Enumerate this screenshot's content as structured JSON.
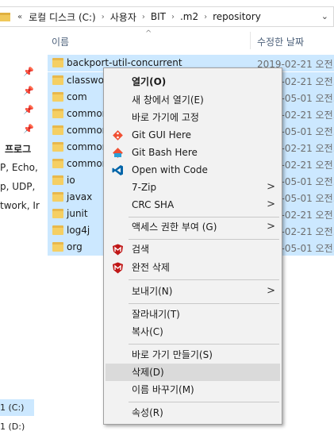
{
  "address": {
    "overflow": "«",
    "crumbs": [
      "로컬 디스크 (C:)",
      "사용자",
      "BIT",
      ".m2",
      "repository"
    ]
  },
  "columns": {
    "name": "이름",
    "date": "수정한 날짜",
    "sort_indicator": "^"
  },
  "nav": {
    "pins": [
      "📌",
      "📌",
      "📌",
      "📌"
    ],
    "texts": [
      "프로그",
      "P, Echo,",
      "p, UDP,",
      "twork, Ir"
    ],
    "drives": [
      "1 (C:)",
      "1 (D:)"
    ]
  },
  "files": [
    {
      "name": "backport-util-concurrent",
      "date": "2019-02-21 오전..."
    },
    {
      "name": "classworlds",
      "date": "2019-02-21 오전..."
    },
    {
      "name": "com",
      "date": "2019-05-01 오전..."
    },
    {
      "name": "commons-",
      "date": "2019-02-21 오전..."
    },
    {
      "name": "commons-",
      "date": "2019-05-01 오전..."
    },
    {
      "name": "commons-",
      "date": "2019-02-21 오전..."
    },
    {
      "name": "commons-",
      "date": "2019-02-21 오전..."
    },
    {
      "name": "io",
      "date": "2019-05-01 오전..."
    },
    {
      "name": "javax",
      "date": "2019-05-01 오전..."
    },
    {
      "name": "junit",
      "date": "2019-02-21 오전..."
    },
    {
      "name": "log4j",
      "date": "2019-02-21 오전..."
    },
    {
      "name": "org",
      "date": "2019-05-01 오전..."
    }
  ],
  "menu": {
    "open": "열기(O)",
    "open_new_window": "새 창에서 열기(E)",
    "pin_quick_access": "바로 가기에 고정",
    "git_gui": "Git GUI Here",
    "git_bash": "Git Bash Here",
    "open_with_code": "Open with Code",
    "sevenzip": "7-Zip",
    "crc_sha": "CRC SHA",
    "grant_access": "액세스 권한 부여 (G)",
    "scan": "검색",
    "full_delete": "완전 삭제",
    "send_to": "보내기(N)",
    "cut": "잘라내기(T)",
    "copy": "복사(C)",
    "create_shortcut": "바로 가기 만들기(S)",
    "delete": "삭제(D)",
    "rename": "이름 바꾸기(M)",
    "properties": "속성(R)",
    "submenu_arrow": ">"
  },
  "colors": {
    "selection": "#cce8ff",
    "menu_bg": "#f2f2f2",
    "menu_hover": "#dadada",
    "vscode_blue": "#0065a9",
    "mcafee_red": "#c01818"
  }
}
